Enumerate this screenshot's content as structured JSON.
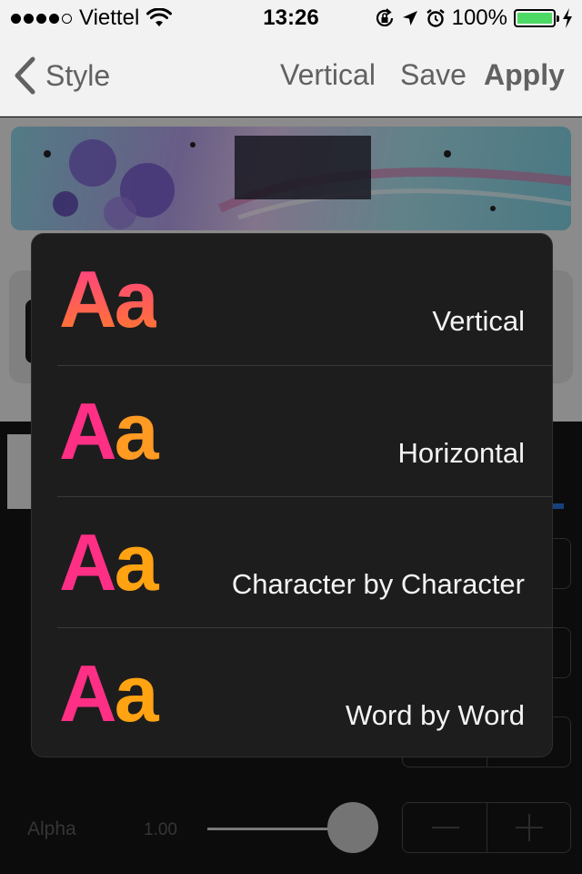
{
  "status_bar": {
    "carrier": "Viettel",
    "time": "13:26",
    "battery": "100%",
    "signal_bars": 4,
    "battery_level": 1.0
  },
  "nav": {
    "back_label": "Style",
    "vertical_label": "Vertical",
    "save_label": "Save",
    "apply_label": "Apply"
  },
  "controls": {
    "alpha_label": "Alpha",
    "alpha_value": "1.00"
  },
  "popover": {
    "sample_A": "A",
    "sample_a": "a",
    "options": [
      {
        "label": "Vertical"
      },
      {
        "label": "Horizontal"
      },
      {
        "label": "Character by Character"
      },
      {
        "label": "Word by Word"
      }
    ]
  },
  "colors": {
    "accent_pink": "#ff2f86",
    "accent_orange": "#ffa313",
    "battery_green": "#4cd964",
    "tab_underline_blue": "#2b6ed8"
  },
  "icons": [
    "wifi-icon",
    "rotation-lock-icon",
    "location-arrow-icon",
    "alarm-icon",
    "battery-icon",
    "charging-bolt-icon",
    "chevron-left-icon"
  ]
}
